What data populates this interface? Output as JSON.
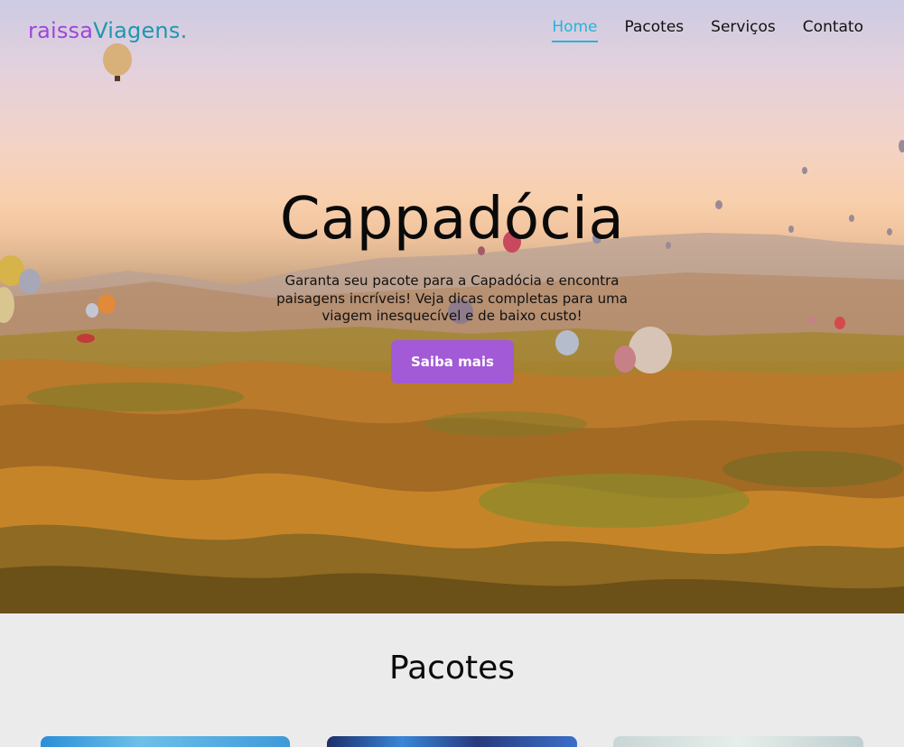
{
  "header": {
    "logo_part1": "raissa",
    "logo_part2": "Viagens",
    "logo_dot": ".",
    "nav": [
      {
        "label": "Home",
        "active": true
      },
      {
        "label": "Pacotes",
        "active": false
      },
      {
        "label": "Serviços",
        "active": false
      },
      {
        "label": "Contato",
        "active": false
      }
    ]
  },
  "hero": {
    "title": "Cappadócia",
    "description": "Garanta seu pacote para a Capadócia e encontra paisagens incríveis! Veja dicas completas para uma viagem inesquecível e de baixo custo!",
    "button_label": "Saiba mais"
  },
  "packages": {
    "title": "Pacotes"
  },
  "colors": {
    "brand_purple": "#9f46d8",
    "brand_teal": "#1f97b0",
    "nav_active": "#27b4d8",
    "button_bg": "#a25ad6",
    "section_bg": "#ebebeb"
  }
}
